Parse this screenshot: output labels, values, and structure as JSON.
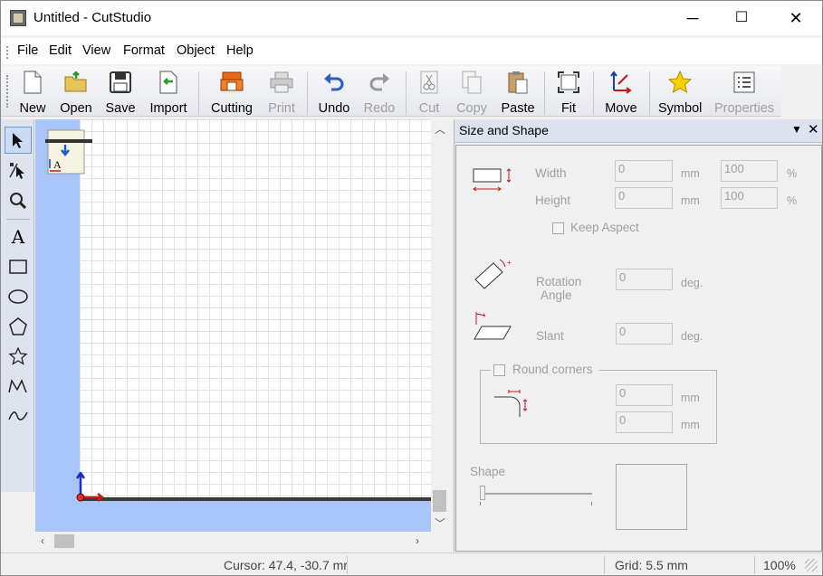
{
  "window": {
    "title": "Untitled - CutStudio",
    "minimize": "─",
    "maximize": "☐",
    "close": "✕"
  },
  "menu": [
    "File",
    "Edit",
    "View",
    "Format",
    "Object",
    "Help"
  ],
  "toolbar": {
    "new": "New",
    "open": "Open",
    "save": "Save",
    "import": "Import",
    "cutting": "Cutting",
    "print": "Print",
    "undo": "Undo",
    "redo": "Redo",
    "cut": "Cut",
    "copy": "Copy",
    "paste": "Paste",
    "fit": "Fit",
    "move": "Move",
    "symbol": "Symbol",
    "properties": "Properties"
  },
  "tools": [
    "select-tool",
    "node-edit-tool",
    "zoom-tool",
    "text-tool",
    "rectangle-tool",
    "ellipse-tool",
    "polygon-tool",
    "star-tool",
    "polyline-tool",
    "curve-tool"
  ],
  "panel": {
    "title": "Size and Shape",
    "width_label": "Width",
    "height_label": "Height",
    "width_value": "0",
    "height_value": "0",
    "width_pct": "100",
    "height_pct": "100",
    "unit_mm": "mm",
    "unit_pct": "%",
    "keep_aspect": "Keep Aspect",
    "rotation_label_1": "Rotation",
    "rotation_label_2": "Angle",
    "rotation_value": "0",
    "unit_deg": "deg.",
    "slant_label": "Slant",
    "slant_value": "0",
    "round_corners": "Round corners",
    "corner_x": "0",
    "corner_y": "0",
    "shape_label": "Shape"
  },
  "status": {
    "cursor": "Cursor: 47.4, -30.7 mr",
    "grid": "Grid: 5.5 mm",
    "zoom": "100%"
  },
  "colors": {
    "workspace": "#a8c4f8",
    "toolbar": "#e9ebf0",
    "disabled": "#a0a0a0"
  }
}
